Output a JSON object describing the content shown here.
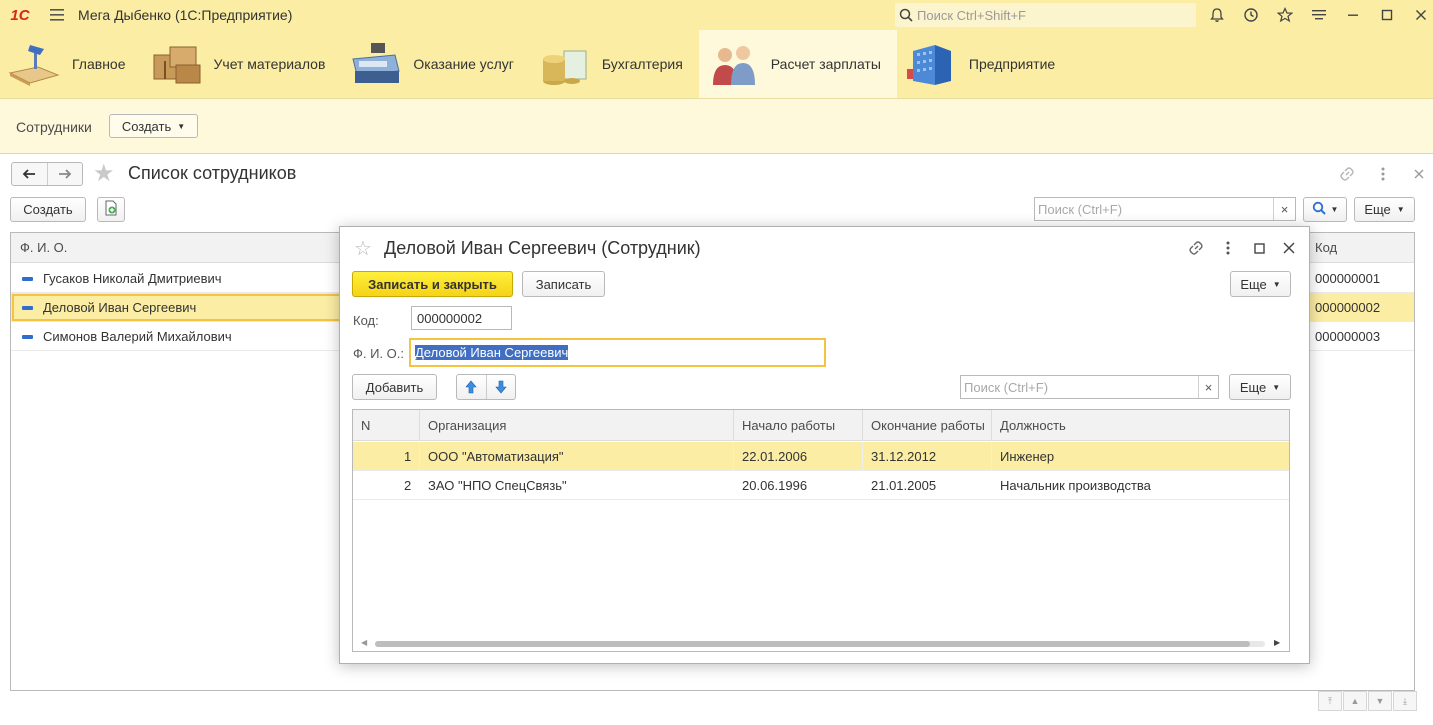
{
  "titlebar": {
    "logo": "1С",
    "title": "Мега Дыбенко  (1С:Предприятие)",
    "search_placeholder": "Поиск Ctrl+Shift+F",
    "icons": [
      "bell-icon",
      "history-icon",
      "star-icon",
      "menu-settings-icon",
      "minimize-icon",
      "maximize-icon",
      "close-icon"
    ]
  },
  "sections": [
    {
      "label": "Главное",
      "icon": "desk-lamp-icon"
    },
    {
      "label": "Учет материалов",
      "icon": "boxes-icon"
    },
    {
      "label": "Оказание услуг",
      "icon": "cash-register-icon"
    },
    {
      "label": "Бухгалтерия",
      "icon": "coins-icon"
    },
    {
      "label": "Расчет зарплаты",
      "icon": "people-icon",
      "active": true
    },
    {
      "label": "Предприятие",
      "icon": "building-icon"
    }
  ],
  "function_panel": {
    "link": "Сотрудники",
    "create": "Создать"
  },
  "list_form": {
    "title": "Список сотрудников",
    "create_button": "Создать",
    "search_placeholder": "Поиск (Ctrl+F)",
    "more_button": "Еще",
    "columns": {
      "name": "Ф. И. О.",
      "code": "Код"
    },
    "rows": [
      {
        "name": "Гусаков Николай Дмитриевич",
        "code": "000000001"
      },
      {
        "name": "Деловой Иван Сергеевич",
        "code": "000000002",
        "selected": true
      },
      {
        "name": "Симонов Валерий Михайлович",
        "code": "000000003"
      }
    ]
  },
  "modal": {
    "title": "Деловой Иван Сергеевич (Сотрудник)",
    "save_close": "Записать и закрыть",
    "save": "Записать",
    "more": "Еще",
    "code_label": "Код:",
    "code_value": "000000002",
    "fio_label": "Ф. И. О.:",
    "fio_value": "Деловой Иван Сергеевич",
    "add_button": "Добавить",
    "search_placeholder": "Поиск (Ctrl+F)",
    "table_more": "Еще",
    "columns": {
      "n": "N",
      "org": "Организация",
      "start": "Начало работы",
      "end": "Окончание работы",
      "position": "Должность"
    },
    "rows": [
      {
        "n": "1",
        "org": "ООО \"Автоматизация\"",
        "start": "22.01.2006",
        "end": "31.12.2012",
        "position": "Инженер",
        "selected": true
      },
      {
        "n": "2",
        "org": "ЗАО \"НПО СпецСвязь\"",
        "start": "20.06.1996",
        "end": "21.01.2005",
        "position": "Начальник производства"
      }
    ]
  },
  "colors": {
    "accent_yellow": "#fbeda4",
    "button_yellow": "#f5d319",
    "selection_border": "#f5c342"
  }
}
